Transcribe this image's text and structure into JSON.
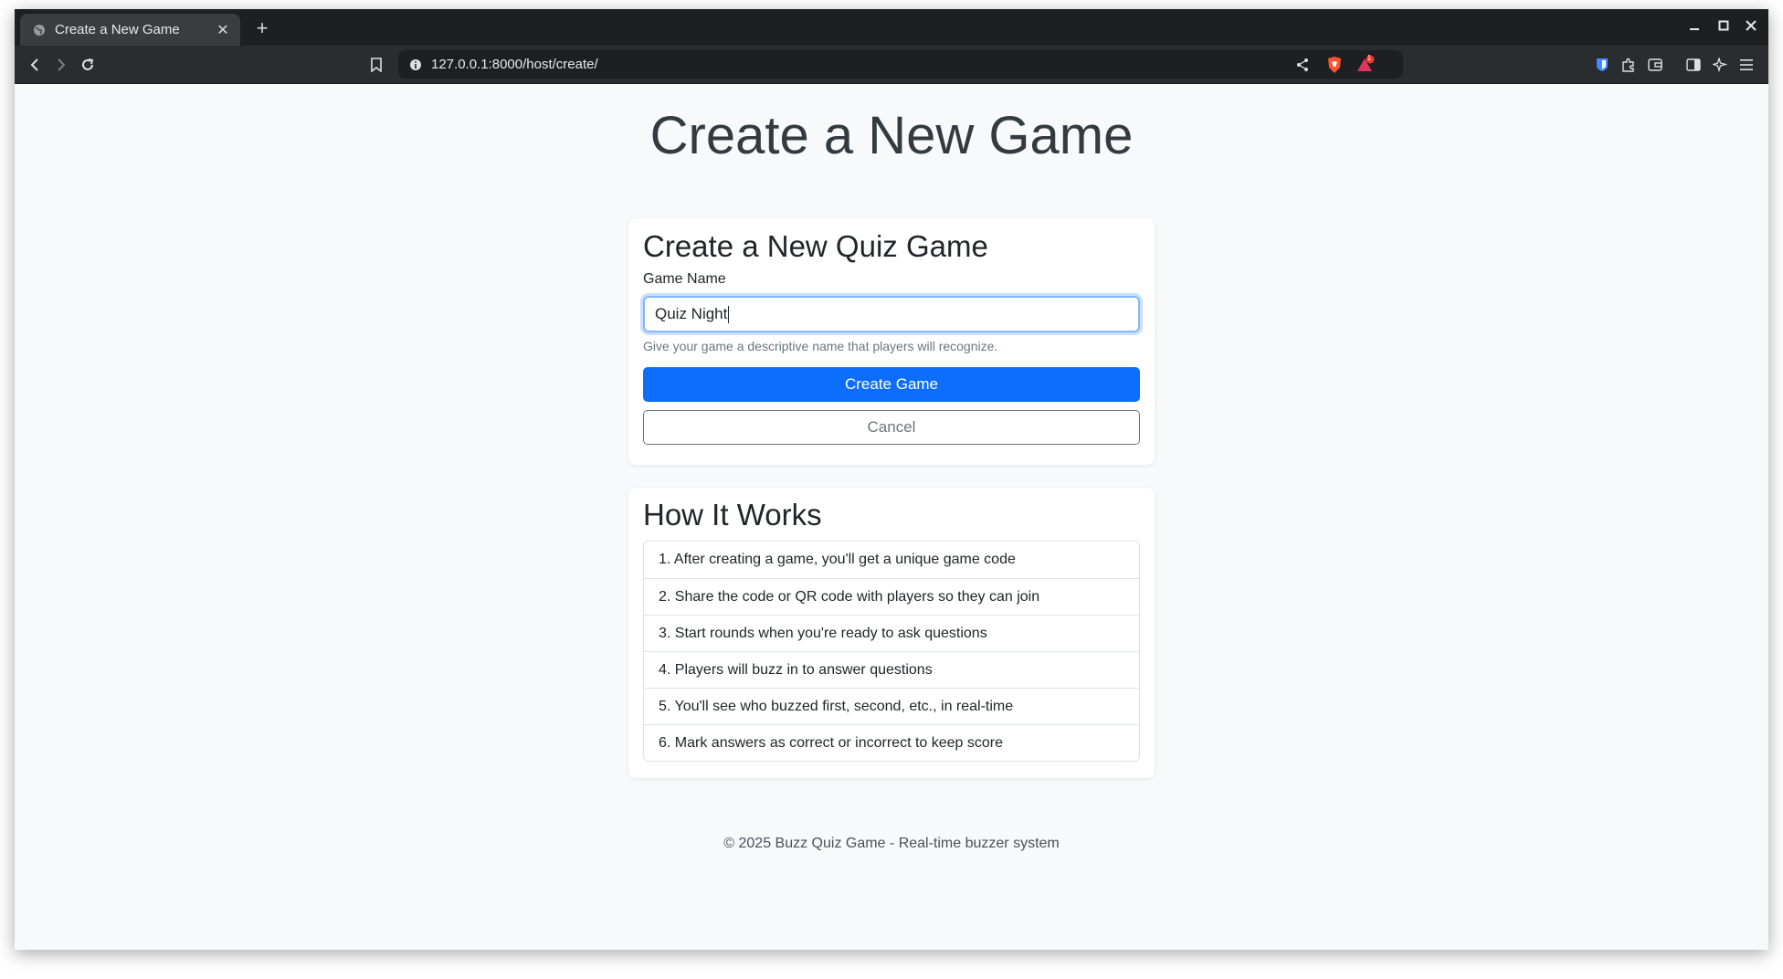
{
  "browser": {
    "tab_title": "Create a New Game",
    "new_tab_label": "+",
    "url": "127.0.0.1:8000/host/create/",
    "notification_count": "1"
  },
  "page": {
    "heading": "Create a New Game",
    "form_card": {
      "title": "Create a New Quiz Game",
      "game_name_label": "Game Name",
      "game_name_value": "Quiz Night",
      "help_text": "Give your game a descriptive name that players will recognize.",
      "create_button": "Create Game",
      "cancel_button": "Cancel"
    },
    "how_card": {
      "title": "How It Works",
      "steps": [
        "1. After creating a game, you'll get a unique game code",
        "2. Share the code or QR code with players so they can join",
        "3. Start rounds when you're ready to ask questions",
        "4. Players will buzz in to answer questions",
        "5. You'll see who buzzed first, second, etc., in real-time",
        "6. Mark answers as correct or incorrect to keep score"
      ]
    },
    "footer": "© 2025 Buzz Quiz Game - Real-time buzzer system"
  },
  "colors": {
    "primary": "#0d6efd",
    "page_bg": "#f8f9fa",
    "browser_chrome": "#2b2c30"
  }
}
